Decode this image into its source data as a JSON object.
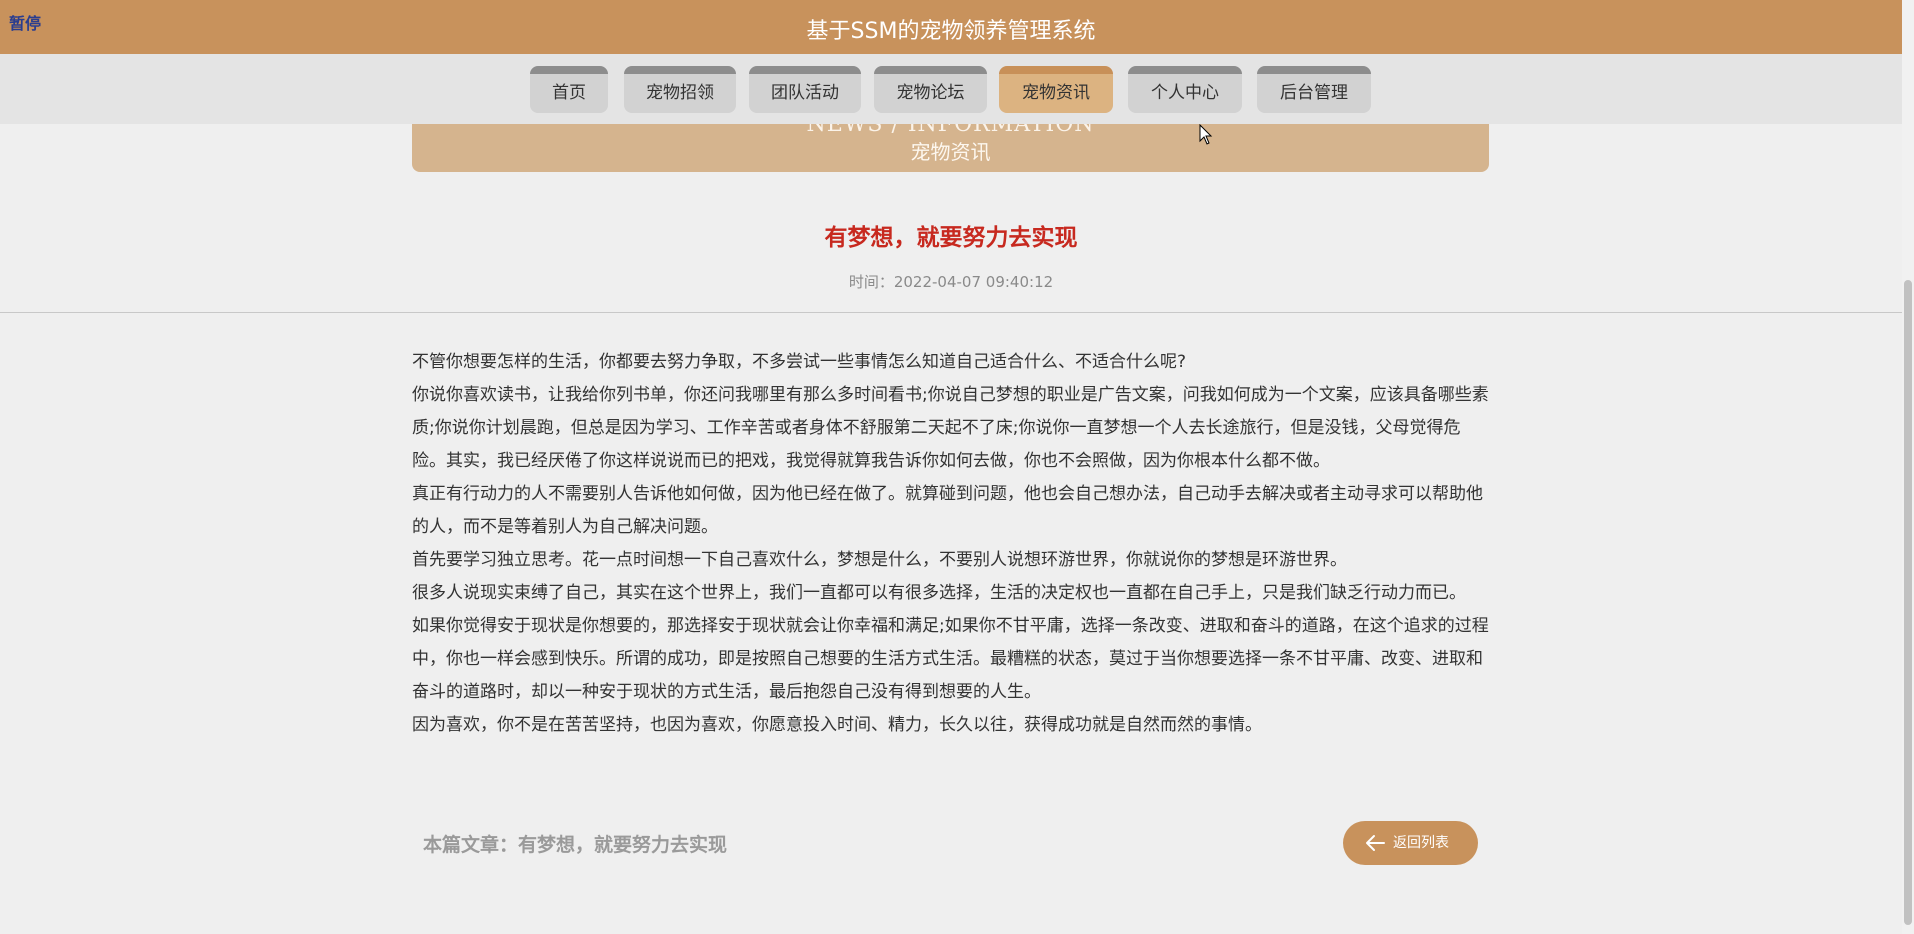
{
  "header": {
    "pause_label": "暂停",
    "site_title": "基于SSM的宠物领养管理系统"
  },
  "nav": {
    "items": [
      {
        "label": "首页"
      },
      {
        "label": "宠物招领"
      },
      {
        "label": "团队活动"
      },
      {
        "label": "宠物论坛"
      },
      {
        "label": "宠物资讯"
      },
      {
        "label": "个人中心"
      },
      {
        "label": "后台管理"
      }
    ],
    "active": "宠物资讯"
  },
  "banner": {
    "english": "NEWS / INFORMATION",
    "chinese": "宠物资讯"
  },
  "article": {
    "title": "有梦想，就要努力去实现",
    "time": "时间：2022-04-07 09:40:12",
    "paragraphs": [
      "不管你想要怎样的生活，你都要去努力争取，不多尝试一些事情怎么知道自己适合什么、不适合什么呢?",
      "你说你喜欢读书，让我给你列书单，你还问我哪里有那么多时间看书;你说自己梦想的职业是广告文案，问我如何成为一个文案，应该具备哪些素质;你说你计划晨跑，但总是因为学习、工作辛苦或者身体不舒服第二天起不了床;你说你一直梦想一个人去长途旅行，但是没钱，父母觉得危险。其实，我已经厌倦了你这样说说而已的把戏，我觉得就算我告诉你如何去做，你也不会照做，因为你根本什么都不做。",
      "真正有行动力的人不需要别人告诉他如何做，因为他已经在做了。就算碰到问题，他也会自己想办法，自己动手去解决或者主动寻求可以帮助他的人，而不是等着别人为自己解决问题。",
      "首先要学习独立思考。花一点时间想一下自己喜欢什么，梦想是什么，不要别人说想环游世界，你就说你的梦想是环游世界。",
      "很多人说现实束缚了自己，其实在这个世界上，我们一直都可以有很多选择，生活的决定权也一直都在自己手上，只是我们缺乏行动力而已。",
      "如果你觉得安于现状是你想要的，那选择安于现状就会让你幸福和满足;如果你不甘平庸，选择一条改变、进取和奋斗的道路，在这个追求的过程中，你也一样会感到快乐。所谓的成功，即是按照自己想要的生活方式生活。最糟糕的状态，莫过于当你想要选择一条不甘平庸、改变、进取和奋斗的道路时，却以一种安于现状的方式生活，最后抱怨自己没有得到想要的人生。",
      "因为喜欢，你不是在苦苦坚持，也因为喜欢，你愿意投入时间、精力，长久以往，获得成功就是自然而然的事情。"
    ]
  },
  "footer": {
    "current_article": "本篇文章：有梦想，就要努力去实现",
    "back_label": "返回列表"
  },
  "colors": {
    "brand": "#c8925c",
    "title_red": "#c7291f"
  }
}
